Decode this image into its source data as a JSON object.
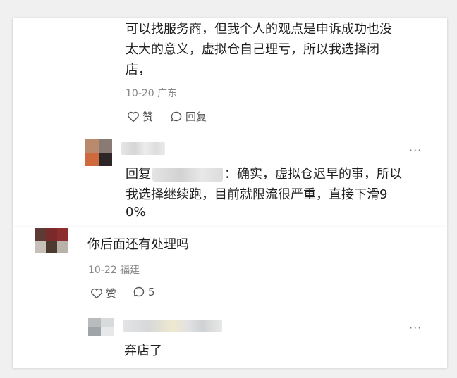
{
  "comment1": {
    "lines": [
      "可以找服务商，但我个人的观点是申诉成功也没",
      "太大的意义，虚拟仓自己理亏，所以我选择闭",
      "店，"
    ],
    "date": "10-20",
    "location": "广东",
    "like_label": "赞",
    "reply_label": "回复"
  },
  "reply1": {
    "reply_prefix": "回复",
    "line1_suffix": "：确实，虚拟仓迟早的事，所以",
    "line2": "我选择继续跑，目前就限流很严重，直接下滑9",
    "line3": "0%",
    "more": "···"
  },
  "comment2": {
    "text": "你后面还有处理吗",
    "date": "10-22",
    "location": "福建",
    "like_label": "赞",
    "reply_count": "5"
  },
  "reply2": {
    "text": "弃店了",
    "more": "···"
  },
  "icons": [
    "heart-icon",
    "comment-bubble-icon"
  ],
  "colors": {
    "meta_gray": "#888888",
    "text": "#1f1f1f"
  }
}
